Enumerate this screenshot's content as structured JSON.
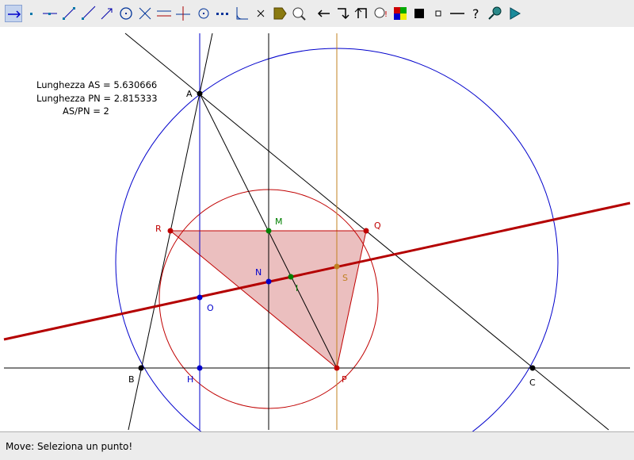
{
  "toolbar": {
    "tools": [
      {
        "name": "move-tool",
        "active": true
      },
      {
        "name": "point-tool"
      },
      {
        "name": "line-tool"
      },
      {
        "name": "segment-tool"
      },
      {
        "name": "ray-tool"
      },
      {
        "name": "vector-tool"
      },
      {
        "name": "circle-tool"
      },
      {
        "name": "intersection-tool"
      },
      {
        "name": "parallel-tool"
      },
      {
        "name": "perpendicular-tool"
      },
      {
        "name": "midpoint-tool"
      },
      {
        "name": "polygon-tool"
      },
      {
        "name": "angle-tool"
      },
      {
        "name": "delete-tool"
      },
      {
        "name": "color-tool"
      },
      {
        "name": "measure-tool"
      },
      {
        "name": "undo-tool"
      },
      {
        "name": "redo-tool"
      },
      {
        "name": "back-tool"
      },
      {
        "name": "macro-tool"
      },
      {
        "name": "palette-tool"
      },
      {
        "name": "fill-tool"
      },
      {
        "name": "small-point-tool"
      },
      {
        "name": "line-style-tool"
      },
      {
        "name": "help-tool"
      },
      {
        "name": "zoom-tool"
      },
      {
        "name": "play-tool"
      }
    ]
  },
  "info": {
    "line1": "Lunghezza AS = 5.630666",
    "line2": "Lunghezza PN = 2.815333",
    "line3": "AS/PN = 2"
  },
  "points": {
    "A": "A",
    "B": "B",
    "C": "C",
    "H": "H",
    "P": "P",
    "O": "O",
    "N": "N",
    "I": "I",
    "S": "S",
    "M": "M",
    "R": "R",
    "Q": "Q"
  },
  "colors": {
    "euler_line": "#b40000",
    "circumcircle": "#0000cc",
    "nine_point_circle": "#c00000",
    "triangle_fill": "#e8b4b4",
    "orange_line": "#c08020",
    "green": "#008000"
  },
  "status": "Move: Seleziona un punto!"
}
